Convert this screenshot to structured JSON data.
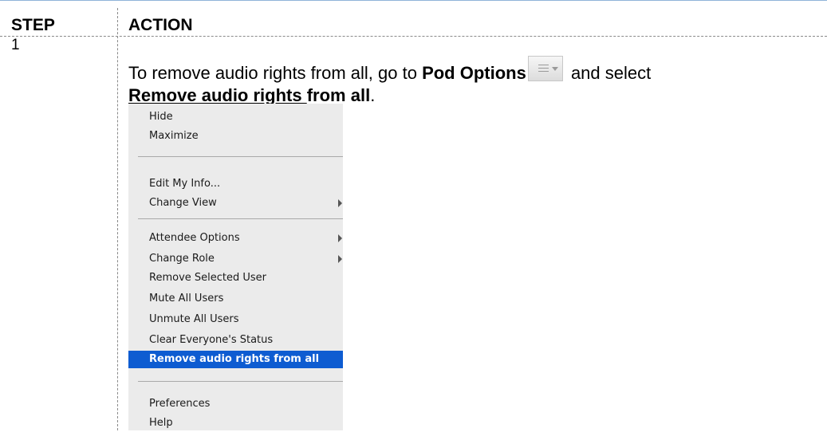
{
  "table": {
    "header_step": "STEP",
    "header_action": "ACTION",
    "step_number": "1"
  },
  "instruction": {
    "part1": "To remove audio rights from all, go to ",
    "pod_options": "Pod Options",
    "part2": " and select",
    "remove_link": "Remove audio rights ",
    "remove_tail": "from all",
    "period": "."
  },
  "pod_options_button": {
    "icon": "pod-options-menu-icon"
  },
  "menu": {
    "items": [
      {
        "label": "Hide"
      },
      {
        "label": "Maximize"
      },
      {
        "label": "Edit My Info..."
      },
      {
        "label": "Change View",
        "submenu": true
      },
      {
        "label": "Attendee Options",
        "submenu": true
      },
      {
        "label": "Change Role",
        "submenu": true
      },
      {
        "label": "Remove Selected User"
      },
      {
        "label": "Mute All Users"
      },
      {
        "label": "Unmute All Users"
      },
      {
        "label": "Clear Everyone's Status"
      },
      {
        "label": "Remove audio rights from all",
        "highlighted": true
      },
      {
        "label": "Preferences"
      },
      {
        "label": "Help"
      }
    ],
    "highlight_color": "#0e5cd1",
    "background_color": "#ebebeb"
  }
}
